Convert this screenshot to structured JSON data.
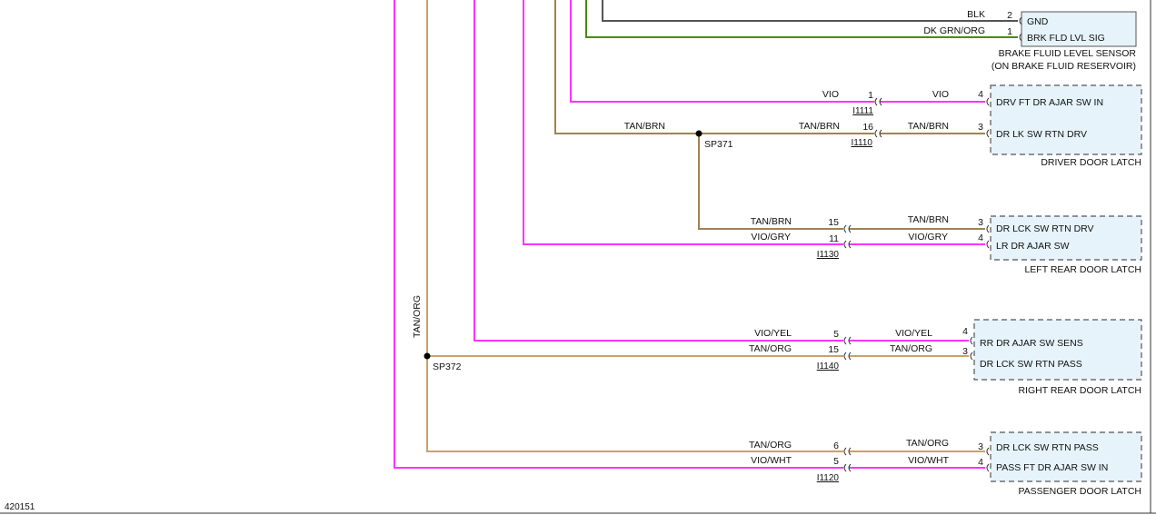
{
  "figure_id": "420151",
  "colors": {
    "vio": "#ff33ff",
    "tan": "#c9a16a",
    "tan_brn": "#9e8450",
    "blk": "#555555",
    "dk_grn_org": "#4a8a14",
    "box_fill": "#e6f3fb",
    "box_border": "#555555"
  },
  "brake_sensor": {
    "pins": [
      {
        "wire": "BLK",
        "pin": "2",
        "name": "GND"
      },
      {
        "wire": "DK GRN/ORG",
        "pin": "1",
        "name": "BRK FLD LVL SIG"
      }
    ],
    "label_line1": "BRAKE FLUID LEVEL SENSOR",
    "label_line2": "(ON BRAKE FLUID RESERVOIR)"
  },
  "driver_door": {
    "rows": [
      {
        "wire_left": "VIO",
        "inline_pin": "1",
        "wire_right": "VIO",
        "pin": "4",
        "name": "DRV FT DR AJAR SW IN"
      },
      {
        "wire_left": "TAN/BRN",
        "inline_pin": "16",
        "wire_right": "TAN/BRN",
        "pin": "3",
        "name": "DR LK SW RTN DRV"
      }
    ],
    "connector_a": "I1111",
    "connector_b": "I1110",
    "label": "DRIVER DOOR LATCH"
  },
  "splice_sp371": {
    "name": "SP371",
    "wire": "TAN/BRN"
  },
  "left_rear": {
    "rows": [
      {
        "wire_left": "TAN/BRN",
        "inline_pin": "15",
        "wire_right": "TAN/BRN",
        "pin": "3",
        "name": "DR LCK SW RTN DRV"
      },
      {
        "wire_left": "VIO/GRY",
        "inline_pin": "11",
        "wire_right": "VIO/GRY",
        "pin": "4",
        "name": "LR DR AJAR SW"
      }
    ],
    "connector": "I1130",
    "label": "LEFT REAR DOOR LATCH"
  },
  "right_rear": {
    "rows": [
      {
        "wire_left": "VIO/YEL",
        "inline_pin": "5",
        "wire_right": "VIO/YEL",
        "pin": "4",
        "name": "RR DR AJAR SW SENS"
      },
      {
        "wire_left": "TAN/ORG",
        "inline_pin": "15",
        "wire_right": "TAN/ORG",
        "pin": "3",
        "name": "DR LCK SW RTN PASS"
      }
    ],
    "connector": "I1140",
    "label": "RIGHT REAR DOOR LATCH"
  },
  "splice_sp372": {
    "name": "SP372",
    "wire": "TAN/ORG"
  },
  "passenger_door": {
    "rows": [
      {
        "wire_left": "TAN/ORG",
        "inline_pin": "6",
        "wire_right": "TAN/ORG",
        "pin": "3",
        "name": "DR LCK SW RTN PASS"
      },
      {
        "wire_left": "VIO/WHT",
        "inline_pin": "5",
        "wire_right": "VIO/WHT",
        "pin": "4",
        "name": "PASS FT DR AJAR SW IN"
      }
    ],
    "connector": "I1120",
    "label": "PASSENGER DOOR LATCH"
  }
}
